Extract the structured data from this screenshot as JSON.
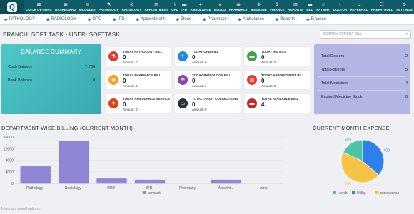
{
  "topnav": {
    "items": [
      {
        "label": "QUICK OPTIONS",
        "icon": "grid-icon"
      },
      {
        "label": "DASHBOARD",
        "icon": "dashboard-icon"
      },
      {
        "label": "MODULES",
        "icon": "modules-icon"
      },
      {
        "label": "PATHOLOGY",
        "icon": "flask-icon"
      },
      {
        "label": "RADIOLOGY",
        "icon": "radiology-icon"
      },
      {
        "label": "APPOINTMENT",
        "icon": "calendar-icon"
      },
      {
        "label": "OPD",
        "icon": "stethoscope-icon"
      },
      {
        "label": "IPD",
        "icon": "bed-icon"
      },
      {
        "label": "AMBULANCE",
        "icon": "ambulance-icon"
      },
      {
        "label": "BLOOD",
        "icon": "blood-drop-icon"
      },
      {
        "label": "PHARMACY",
        "icon": "pill-icon"
      },
      {
        "label": "MEDICINE",
        "icon": "medicine-icon"
      },
      {
        "label": "FINANCE",
        "icon": "finance-icon"
      },
      {
        "label": "REPORTS",
        "icon": "reports-icon"
      },
      {
        "label": "BED",
        "icon": "bed-icon"
      },
      {
        "label": "PATIENT",
        "icon": "patient-icon"
      },
      {
        "label": "DOCTOR",
        "icon": "doctor-icon"
      },
      {
        "label": "REFERRAL",
        "icon": "referral-icon"
      },
      {
        "label": "HR&PAYROLL",
        "icon": "hr-icon"
      },
      {
        "label": "SETTINGS",
        "icon": "gear-icon"
      }
    ]
  },
  "subnav": {
    "items": [
      "PATHOLOGY",
      "RADIOLOGY",
      "OPD",
      "IPD",
      "Appointment",
      "Blood",
      "Pharmacy",
      "Ambulance",
      "Reports",
      "Finance"
    ]
  },
  "branch": {
    "title": "BRANCH: SOFT TASK - USER: SOFTTASK",
    "search_placeholder": "SEARCH PATIENT BILL"
  },
  "balance": {
    "title": "BALANCE SUMMARY",
    "cash_label": "Cash Balance",
    "cash_value": "7,700",
    "bank_label": "Bank Balance",
    "bank_value": "0"
  },
  "cards": [
    {
      "caption": "TODAY PATHOLOGY BILL",
      "value": "0",
      "amount": "Amount: 0",
      "icon": "flask-icon",
      "color": "#e53935"
    },
    {
      "caption": "TODAY OPD BILL",
      "value": "0",
      "amount": "Amount: 0",
      "icon": "stethoscope-icon",
      "color": "#1e88e5"
    },
    {
      "caption": "TODAY IPD BILL",
      "value": "0",
      "amount": "Amount: 0",
      "icon": "bed-icon",
      "color": "#43a047"
    },
    {
      "caption": "TODAY PHARMACY BILL",
      "value": "0",
      "amount": "Amount: 0",
      "icon": "pill-icon",
      "color": "#f4a024"
    },
    {
      "caption": "TODAY RADIOLOGY BILL",
      "value": "0",
      "amount": "Amount: 0",
      "icon": "radiology-icon",
      "color": "#8e44ad"
    },
    {
      "caption": "TODAY APPOINTMENT BILL",
      "value": "0",
      "amount": "Amount: 0",
      "icon": "calendar-icon",
      "color": "#e53935"
    },
    {
      "caption": "TODAY AMBULANCE SERVICE",
      "value": "0",
      "amount": "Amount: 0",
      "icon": "ambulance-icon",
      "color": "#d84315"
    },
    {
      "caption": "TOTAL TODAY COLLECTIONS",
      "value": "0",
      "amount": "Amount: 0",
      "icon": "wallet-icon",
      "color": "#263238"
    },
    {
      "caption": "TOTAL AVAILABLE BED",
      "value": "4",
      "amount": "",
      "icon": "bed-icon",
      "color": "#c62828"
    }
  ],
  "summary": [
    {
      "label": "Total Doctors",
      "value": "2"
    },
    {
      "label": "Total Patients",
      "value": "5"
    },
    {
      "label": "Total Medicines",
      "value": "4"
    },
    {
      "label": "Expired Medicine Stock",
      "value": "0"
    }
  ],
  "dept_heading": "DEPARTMENT-WISE BILLING (CURRENT MONTH)",
  "expense_heading": "CURRENT MONTH EXPENSE",
  "footer": "Important saved options...",
  "colors": {
    "bar": "#8f86d6",
    "nav": "#0f5d68",
    "lunch": "#4dc3a5",
    "utility": "#2f80ed",
    "conveyance": "#f6c344"
  },
  "chart_data": [
    {
      "type": "bar",
      "categories": [
        "Pathology",
        "Radiology",
        "OPD",
        "IPD",
        "Pharmacy",
        "Appoint..",
        "Amb"
      ],
      "series": [
        {
          "name": "amount",
          "values": [
            5800,
            14500,
            1600,
            1200,
            0,
            1200,
            0
          ]
        }
      ],
      "ylim": [
        0,
        16000
      ],
      "yticks": [
        0,
        4000,
        8000,
        12000,
        16000
      ],
      "ytick_labels": [
        "0",
        "4000",
        "8000",
        "12000",
        "16000"
      ],
      "legend": "bottom",
      "grid": true
    },
    {
      "type": "pie",
      "labels": [
        "Lunch",
        "Utility",
        "conveyance"
      ],
      "values": [
        200,
        400,
        500
      ],
      "data_labels": [
        "200",
        "400",
        "500"
      ],
      "legend": "bottom"
    }
  ]
}
